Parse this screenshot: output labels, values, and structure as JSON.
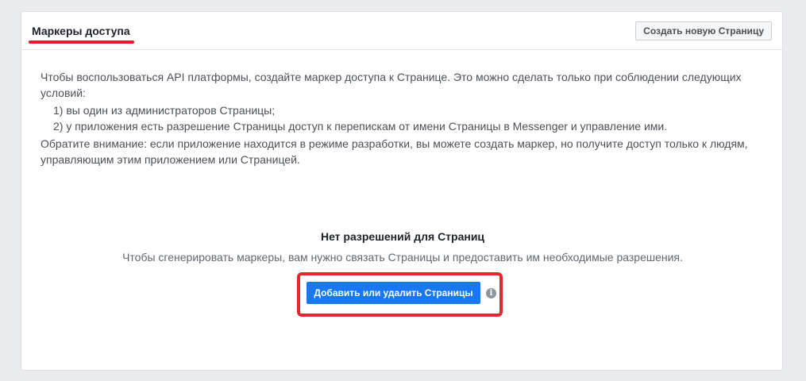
{
  "header": {
    "title": "Маркеры доступа",
    "create_button_label": "Создать новую Страницу",
    "accent_color": "#e5192a"
  },
  "intro": {
    "paragraph": "Чтобы воспользоваться API платформы, создайте маркер доступа к Странице. Это можно сделать только при соблюдении следующих условий:",
    "conditions": [
      "1) вы один из администраторов Страницы;",
      "2) у приложения есть разрешение Страницы доступ к перепискам от имени Страницы в Messenger и управление ими."
    ],
    "note": "Обратите внимание: если приложение находится в режиме разработки, вы можете создать маркер, но получите доступ только к людям, управляющим этим приложением или Страницей."
  },
  "empty_state": {
    "title": "Нет разрешений для Страниц",
    "description": "Чтобы сгенерировать маркеры, вам нужно связать Страницы и предоставить им необходимые разрешения.",
    "button_label": "Добавить или удалить Страницы",
    "button_color": "#1877f2",
    "highlight_color": "#e0282e",
    "info_icon": "info-icon",
    "info_glyph": "i"
  }
}
